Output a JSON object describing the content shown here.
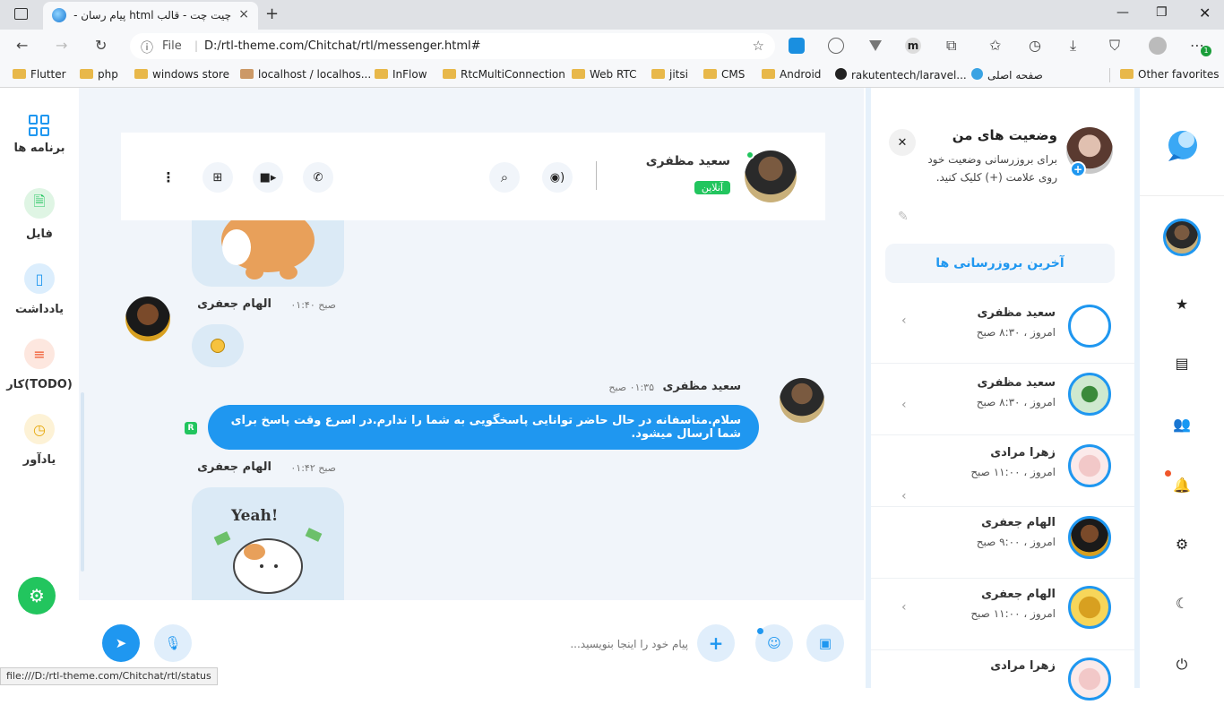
{
  "browser": {
    "tab_title": "چیت چت - قالب html پیام رسان -",
    "tab_close": "×",
    "new_tab": "+",
    "address_scheme": "File",
    "address_url": "D:/rtl-theme.com/Chitchat/rtl/messenger.html#",
    "bookmarks": [
      "Flutter",
      "php",
      "windows store",
      "localhost / localhos...",
      "InFlow",
      "RtcMultiConnection",
      "Web RTC",
      "jitsi",
      "CMS",
      "Android",
      "rakutentech/laravel...",
      "صفحه اصلی"
    ],
    "other_favorites": "Other favorites",
    "status_url": "file:///D:/rtl-theme.com/Chitchat/rtl/status"
  },
  "left_apps": {
    "apps_label": "برنامه ها",
    "file_label": "فایل",
    "note_label": "یادداشت",
    "todo_label": "کار(TODO)",
    "reminder_label": "یادآور"
  },
  "chat": {
    "contact_name": "سعید مظفری",
    "contact_status": "آنلاین",
    "messages": [
      {
        "name": "الهام جعفری",
        "time": "صبح ۰۱:۴۰"
      },
      {
        "name": "سعید مظفری",
        "time": "۰۱:۳۵ صبح",
        "text": "سلام.متاسفانه در حال حاضر توانایی پاسخگویی به شما را ندارم.در اسرع وقت پاسخ برای شما ارسال میشود."
      },
      {
        "name": "الهام جعفری",
        "time": "صبح ۰۱:۴۲"
      }
    ],
    "read_badge": "R",
    "sticker_text": "Yeah!",
    "input_placeholder": "پیام خود را اینجا بنویسید..."
  },
  "sidebar": {
    "status_title": "وضعیت های من",
    "status_hint": "برای بروزرسانی وضعیت خود روی علامت (+) کلیک کنید.",
    "recent_title": "آخرین بروزرسانی ها",
    "statuses": [
      {
        "name": "سعید مظفری",
        "time": "امروز ، ۸:۳۰ صبح"
      },
      {
        "name": "سعید مظفری",
        "time": "امروز ، ۸:۳۰ صبح"
      },
      {
        "name": "زهرا مرادی",
        "time": "امروز ، ۱۱:۰۰ صبح"
      },
      {
        "name": "الهام جعفری",
        "time": "امروز ، ۹:۰۰ صبح"
      },
      {
        "name": "الهام جعفری",
        "time": "امروز ، ۱۱:۰۰ صبح"
      },
      {
        "name": "زهرا مرادی",
        "time": ""
      }
    ]
  },
  "colors": {
    "accent": "#1f97f0",
    "online": "#22c55e",
    "chat_bg": "#f1f5fa"
  }
}
